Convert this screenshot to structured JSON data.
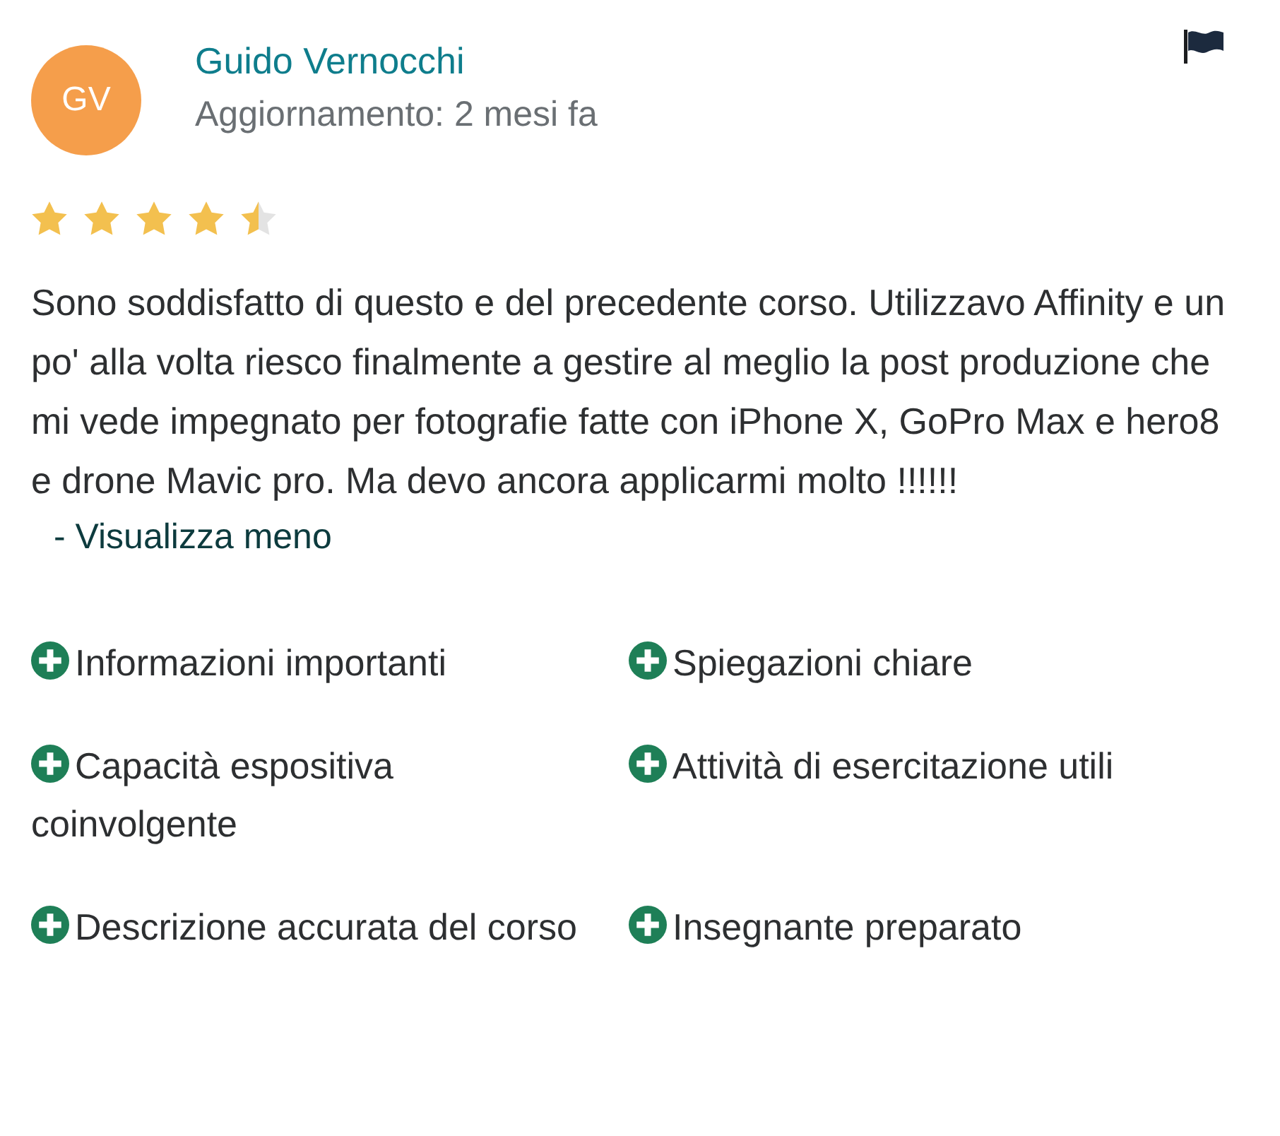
{
  "review": {
    "avatar_initials": "GV",
    "author": "Guido Vernocchi",
    "updated": "Aggiornamento: 2 mesi fa",
    "stars": 4.5,
    "text": "Sono soddisfatto di questo e del precedente corso. Utilizzavo Affinity e un po' alla volta riesco finalmente a gestire al meglio la post produzione che mi vede impegnato per fotografie fatte con iPhone X, GoPro Max e hero8 e drone Mavic pro. Ma devo ancora applicarmi molto !!!!!!",
    "toggle": "- Visualizza meno",
    "tags": [
      {
        "label": "Informazioni importanti"
      },
      {
        "label": "Spiegazioni chiare"
      },
      {
        "label": "Capacità espositiva coinvolgente"
      },
      {
        "label": "Attività di esercitazione utili"
      },
      {
        "label": "Descrizione accurata del corso"
      },
      {
        "label": "Insegnante preparato"
      }
    ]
  }
}
